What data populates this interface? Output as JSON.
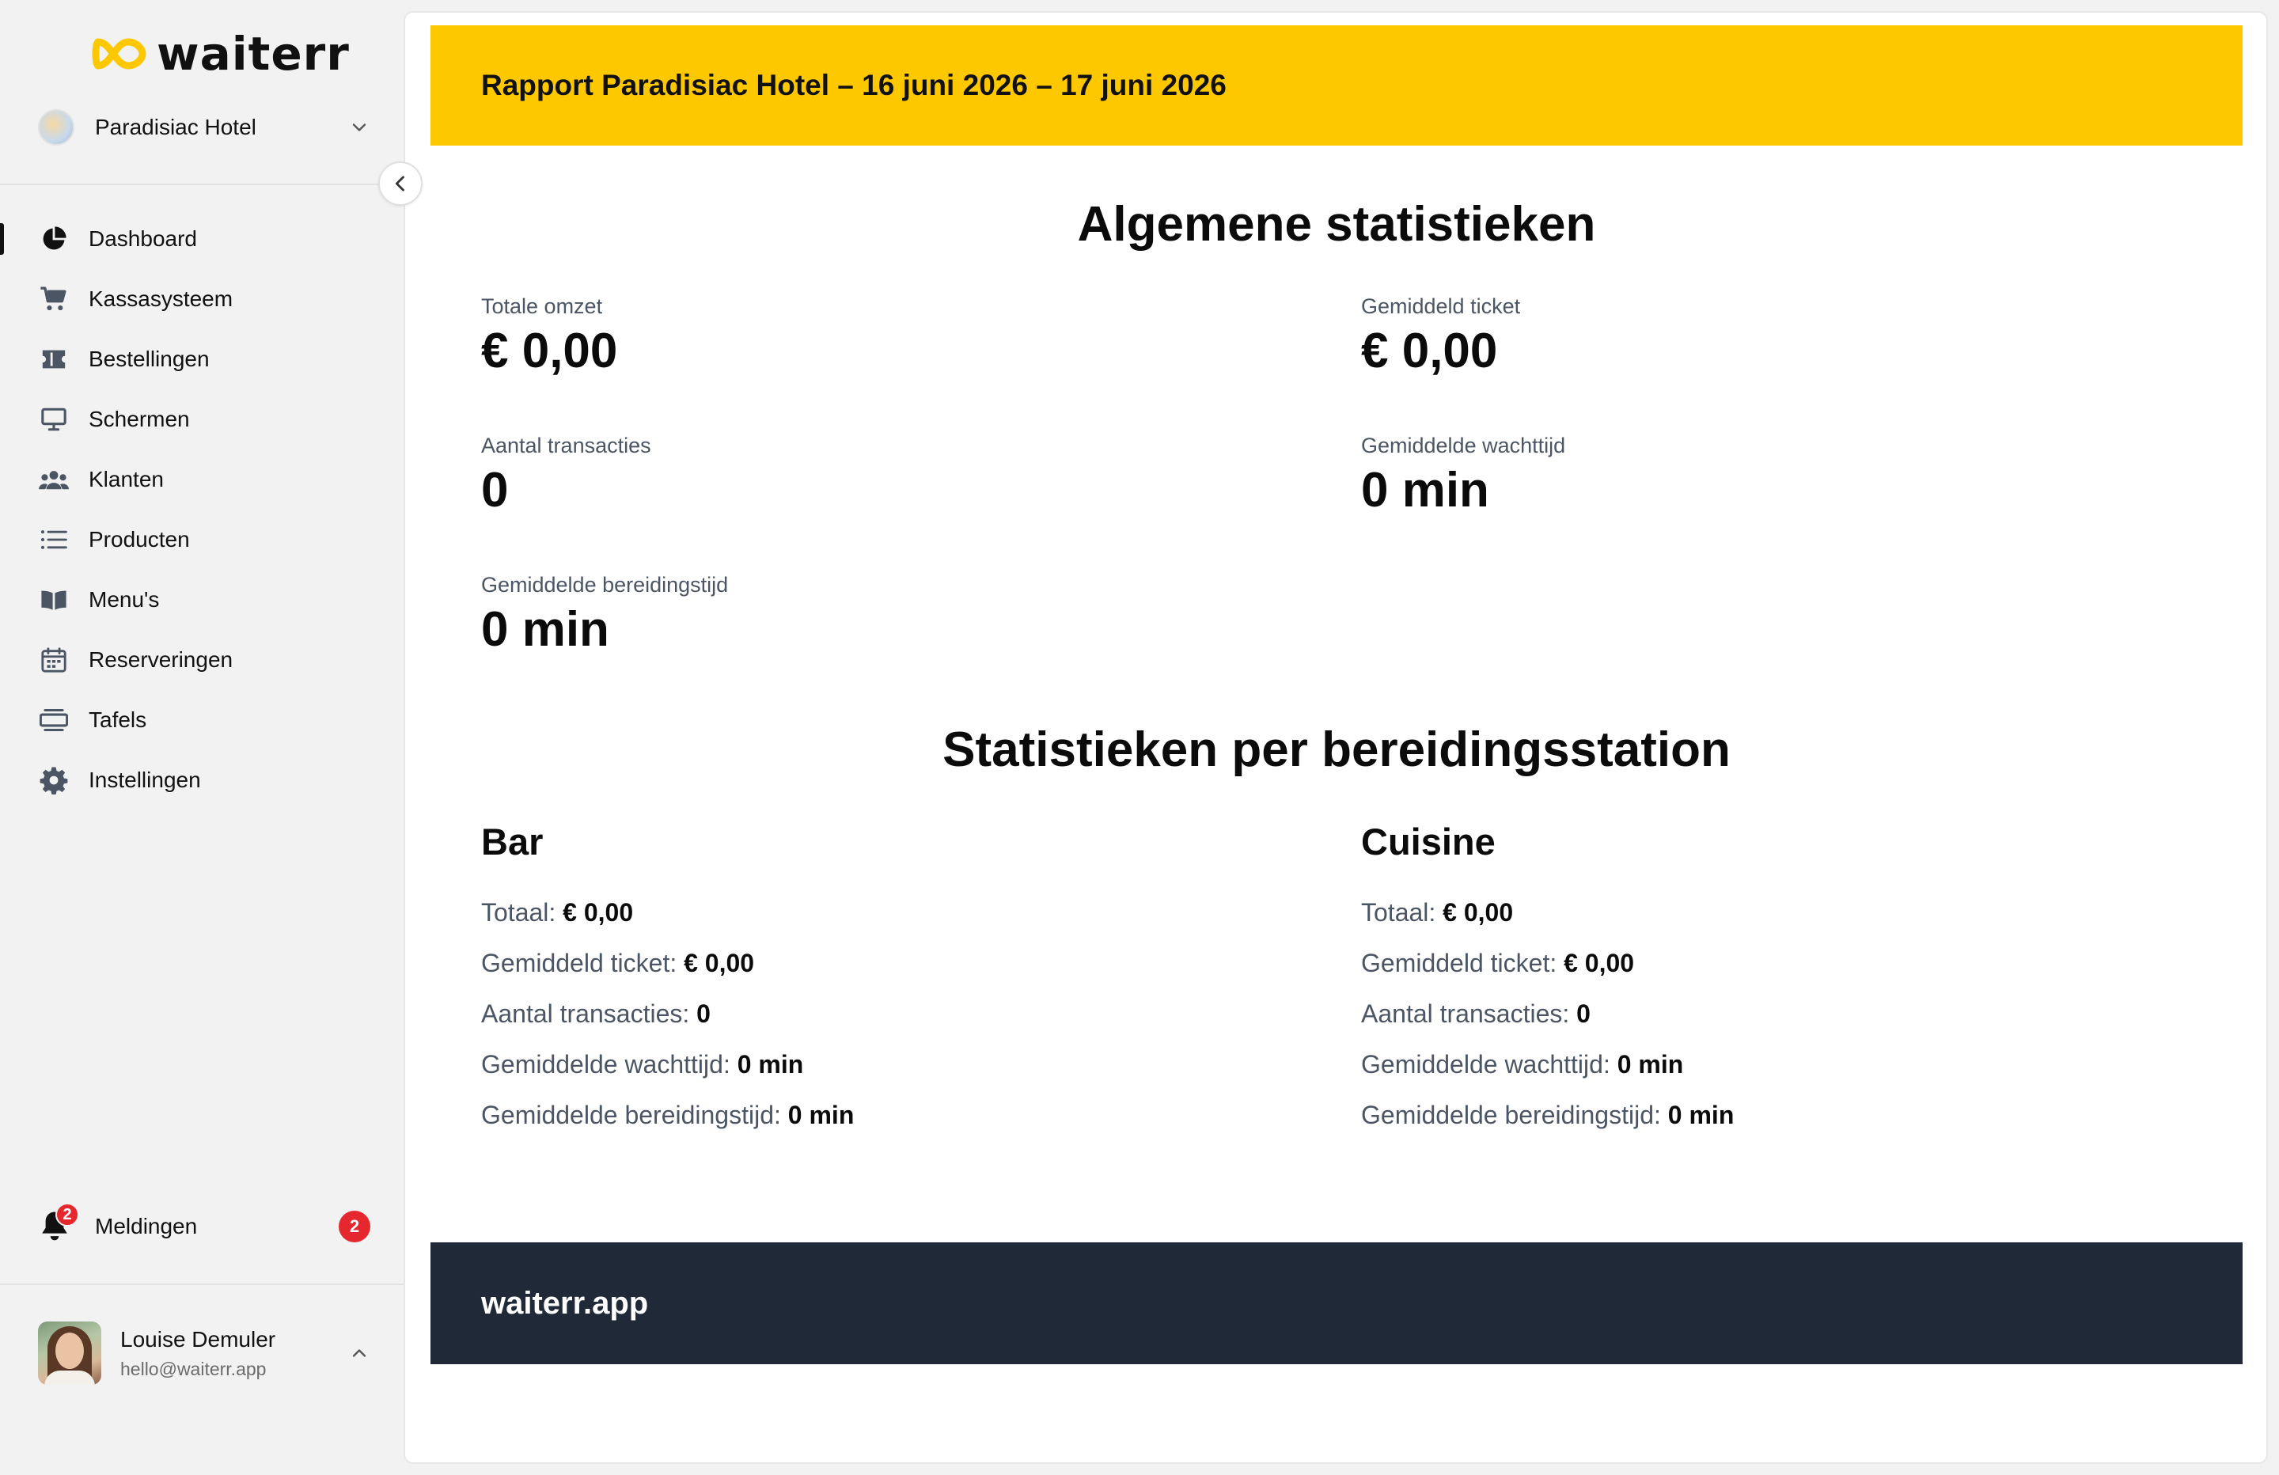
{
  "app": {
    "logo_text": "waiterr",
    "brand_color": "#fdc800"
  },
  "venue": {
    "name": "Paradisiac Hotel"
  },
  "nav": {
    "items": [
      {
        "label": "Dashboard",
        "icon": "pie-chart-icon"
      },
      {
        "label": "Kassasysteem",
        "icon": "cart-icon"
      },
      {
        "label": "Bestellingen",
        "icon": "ticket-icon"
      },
      {
        "label": "Schermen",
        "icon": "monitor-icon"
      },
      {
        "label": "Klanten",
        "icon": "users-icon"
      },
      {
        "label": "Producten",
        "icon": "list-icon"
      },
      {
        "label": "Menu's",
        "icon": "book-icon"
      },
      {
        "label": "Reserveringen",
        "icon": "calendar-icon"
      },
      {
        "label": "Tafels",
        "icon": "table-icon"
      },
      {
        "label": "Instellingen",
        "icon": "gear-icon"
      }
    ],
    "active_index": 0
  },
  "notifications": {
    "label": "Meldingen",
    "badge": "2",
    "count": "2"
  },
  "user": {
    "name": "Louise Demuler",
    "email": "hello@waiterr.app"
  },
  "report": {
    "title": "Rapport Paradisiac Hotel – 16 juni 2026 – 17 juni 2026",
    "general_title": "Algemene statistieken",
    "stats": {
      "total_revenue": {
        "label": "Totale omzet",
        "value": "€ 0,00"
      },
      "avg_ticket": {
        "label": "Gemiddeld ticket",
        "value": "€ 0,00"
      },
      "transactions": {
        "label": "Aantal transacties",
        "value": "0"
      },
      "avg_wait": {
        "label": "Gemiddelde wachttijd",
        "value": "0 min"
      },
      "avg_prep": {
        "label": "Gemiddelde bereidingstijd",
        "value": "0 min"
      }
    },
    "station_title": "Statistieken per bereidingsstation",
    "stations": [
      {
        "name": "Bar",
        "rows": [
          {
            "label": "Totaal:",
            "value": "€ 0,00"
          },
          {
            "label": "Gemiddeld ticket:",
            "value": "€ 0,00"
          },
          {
            "label": "Aantal transacties:",
            "value": "0"
          },
          {
            "label": "Gemiddelde wachttijd:",
            "value": "0 min"
          },
          {
            "label": "Gemiddelde bereidingstijd:",
            "value": "0 min"
          }
        ]
      },
      {
        "name": "Cuisine",
        "rows": [
          {
            "label": "Totaal:",
            "value": "€ 0,00"
          },
          {
            "label": "Gemiddeld ticket:",
            "value": "€ 0,00"
          },
          {
            "label": "Aantal transacties:",
            "value": "0"
          },
          {
            "label": "Gemiddelde wachttijd:",
            "value": "0 min"
          },
          {
            "label": "Gemiddelde bereidingstijd:",
            "value": "0 min"
          }
        ]
      }
    ],
    "footer": "waiterr.app"
  }
}
